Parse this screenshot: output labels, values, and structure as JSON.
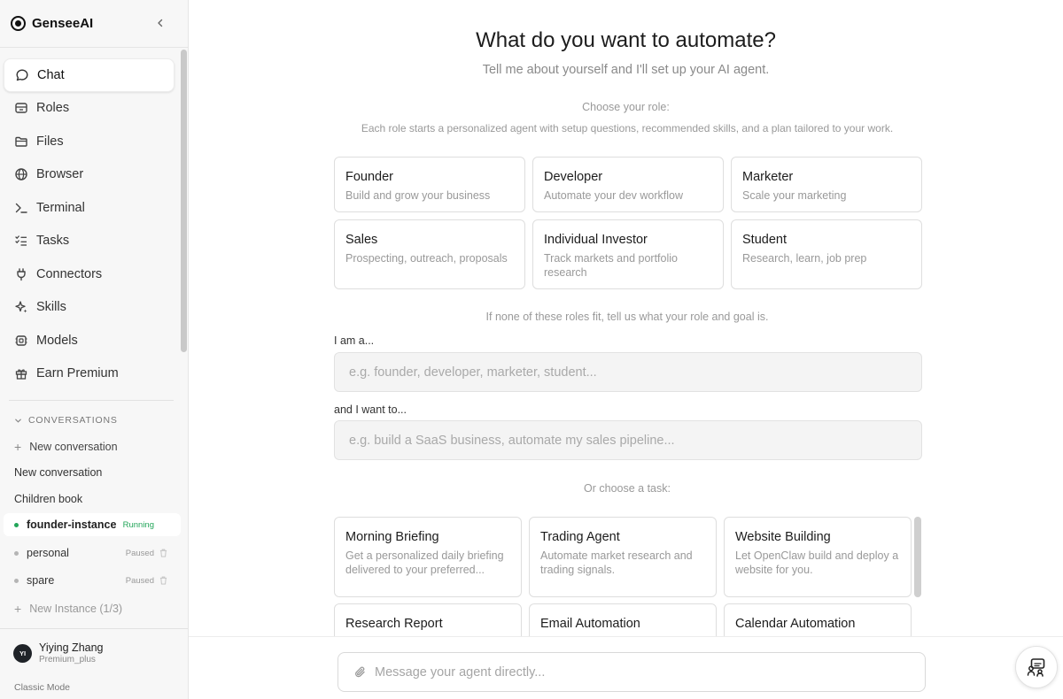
{
  "brand": {
    "name": "GenseeAI"
  },
  "nav": [
    {
      "label": "Chat",
      "icon": "chat-icon"
    },
    {
      "label": "Roles",
      "icon": "roles-icon"
    },
    {
      "label": "Files",
      "icon": "folder-icon"
    },
    {
      "label": "Browser",
      "icon": "globe-icon"
    },
    {
      "label": "Terminal",
      "icon": "terminal-icon"
    },
    {
      "label": "Tasks",
      "icon": "tasks-icon"
    },
    {
      "label": "Connectors",
      "icon": "plug-icon"
    },
    {
      "label": "Skills",
      "icon": "sparkle-icon"
    },
    {
      "label": "Models",
      "icon": "chip-icon"
    },
    {
      "label": "Earn Premium",
      "icon": "gift-icon"
    }
  ],
  "conversations": {
    "header": "CONVERSATIONS",
    "new_label": "New conversation",
    "items": [
      "New conversation",
      "Children book"
    ]
  },
  "instances": [
    {
      "name": "founder-instance",
      "status": "Running",
      "color": "#22a559"
    },
    {
      "name": "personal",
      "status": "Paused",
      "color": "#b5b5b5"
    },
    {
      "name": "spare",
      "status": "Paused",
      "color": "#b5b5b5"
    }
  ],
  "new_instance": "New Instance (1/3)",
  "user": {
    "initials": "YI",
    "name": "Yiying Zhang",
    "plan": "Premium_plus"
  },
  "classic_mode": "Classic Mode",
  "main": {
    "title": "What do you want to automate?",
    "subtitle": "Tell me about yourself and I'll set up your AI agent.",
    "choose_role": "Choose your role:",
    "role_desc": "Each role starts a personalized agent with setup questions, recommended skills, and a plan tailored to your work.",
    "roles": [
      {
        "title": "Founder",
        "desc": "Build and grow your business"
      },
      {
        "title": "Developer",
        "desc": "Automate your dev workflow"
      },
      {
        "title": "Marketer",
        "desc": "Scale your marketing"
      },
      {
        "title": "Sales",
        "desc": "Prospecting, outreach, proposals"
      },
      {
        "title": "Individual Investor",
        "desc": "Track markets and portfolio research"
      },
      {
        "title": "Student",
        "desc": "Research, learn, job prep"
      }
    ],
    "none_fit": "If none of these roles fit, tell us what your role and goal is.",
    "iam_label": "I am a...",
    "iam_placeholder": "e.g. founder, developer, marketer, student...",
    "want_label": "and I want to...",
    "want_placeholder": "e.g. build a SaaS business, automate my sales pipeline...",
    "or_task": "Or choose a task:",
    "tasks": [
      {
        "title": "Morning Briefing",
        "desc": "Get a personalized daily briefing delivered to your preferred..."
      },
      {
        "title": "Trading Agent",
        "desc": "Automate market research and trading signals."
      },
      {
        "title": "Website Building",
        "desc": "Let OpenClaw build and deploy a website for you."
      },
      {
        "title": "Research Report",
        "desc": ""
      },
      {
        "title": "Email Automation",
        "desc": ""
      },
      {
        "title": "Calendar Automation",
        "desc": ""
      }
    ],
    "message_placeholder": "Message your agent directly..."
  }
}
